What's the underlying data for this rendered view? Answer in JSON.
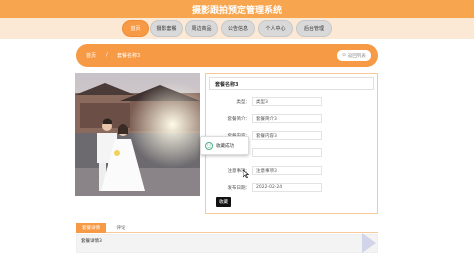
{
  "header": {
    "title": "摄影跟拍预定管理系统"
  },
  "nav": [
    {
      "label": "首页",
      "active": true
    },
    {
      "label": "摄影套餐",
      "active": false
    },
    {
      "label": "周边商品",
      "active": false
    },
    {
      "label": "公告信息",
      "active": false
    },
    {
      "label": "个人中心",
      "active": false
    },
    {
      "label": "后台管理",
      "active": false
    }
  ],
  "breadcrumb": {
    "home": "首页",
    "sep": "/",
    "current": "套餐名称3",
    "back": "返回列表"
  },
  "detail": {
    "name": "套餐名称3",
    "rows": [
      {
        "label": "类型：",
        "value": "类型3"
      },
      {
        "label": "套餐简介：",
        "value": "套餐简介3"
      },
      {
        "label": "套餐内容：",
        "value": "套餐内容3"
      },
      {
        "label": "套餐价格：",
        "value": ""
      },
      {
        "label": "注意事项：",
        "value": "注意事项3"
      },
      {
        "label": "发布日期：",
        "value": "2022-02-24"
      }
    ],
    "fav_button": "收藏"
  },
  "toast": {
    "text": "收藏成功"
  },
  "tabs": [
    {
      "label": "套餐详情",
      "active": true
    },
    {
      "label": "评论",
      "active": false
    }
  ],
  "tab_content": "套餐详情3",
  "colors": {
    "accent": "#f79a45",
    "header": "#f7a64f",
    "nav_bg": "#fbe9d6"
  }
}
